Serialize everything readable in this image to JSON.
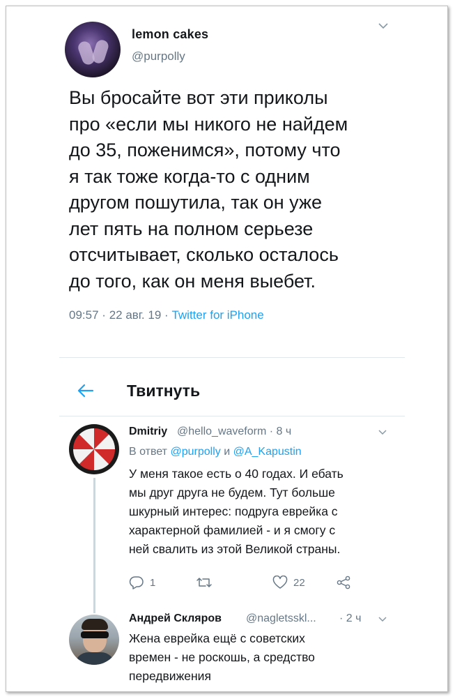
{
  "main_tweet": {
    "name": "lemon cakes",
    "handle": "@purpolly",
    "text": "Вы бросайте вот эти приколы\nпро «если мы никого не найдем\nдо 35, поженимся», потому что\nя так тоже когда-то с одним\nдругом пошутила, так он уже\nлет пять на полном серьезе\nотсчитывает, сколько осталось\nдо того, как он меня выебет.",
    "time": "09:57",
    "date": "22 авг. 19",
    "source": "Twitter for iPhone",
    "sep": "·"
  },
  "header": {
    "title": "Твитнуть",
    "back_icon": "arrow-left-icon"
  },
  "replies": [
    {
      "name": "Dmitriy",
      "handle": "@hello_waveform",
      "age": "8 ч",
      "reply_prefix": "В ответ",
      "reply_mention_1": "@purpolly",
      "reply_and": "и",
      "reply_mention_2": "@A_Kapustin",
      "text": "У меня такое есть о 40 годах. И ебать\nмы друг друга не будем. Тут больше\nшкурный интерес: подруга еврейка с\nхарактерной фамилией - и я смогу с\nней свалить из этой Великой страны.",
      "replies_count": "1",
      "retweets_count": "",
      "likes_count": "22"
    },
    {
      "name": "Андрей Скляров",
      "handle": "@nagletsskl...",
      "age": "2 ч",
      "text": "Жена еврейка ещё с советских\nвремен - не роскошь, а средство\nпередвижения"
    }
  ],
  "colors": {
    "accent": "#1da1f2",
    "secondary_text": "#657786",
    "primary_text": "#14171a",
    "divider": "#e1e8ed"
  }
}
